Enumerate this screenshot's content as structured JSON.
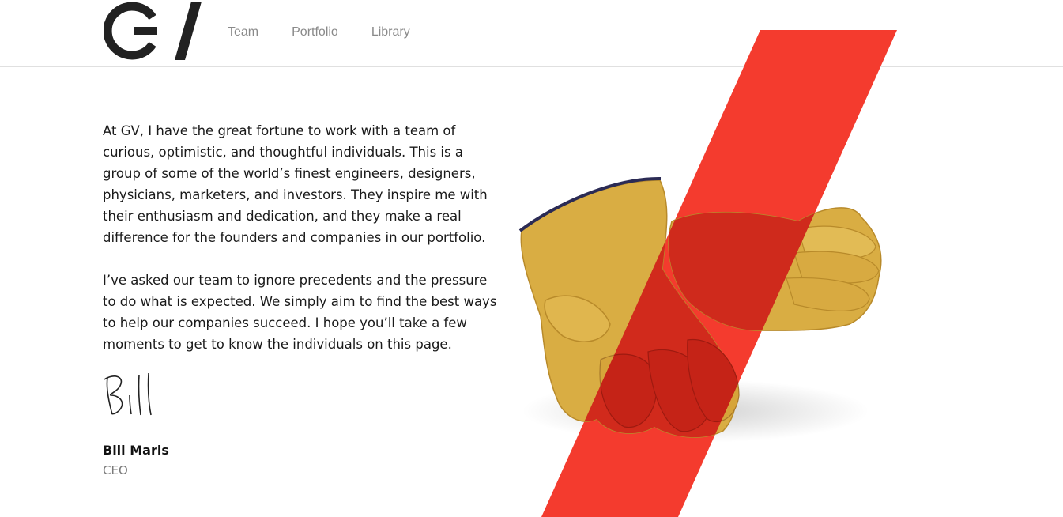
{
  "brand": {
    "logo_text": "GV",
    "logo_color": "#222222"
  },
  "nav": {
    "items": [
      {
        "label": "Team"
      },
      {
        "label": "Portfolio"
      },
      {
        "label": "Library"
      }
    ]
  },
  "intro": {
    "paragraphs": [
      "At GV, I have the great fortune to work with a team of curious, optimistic, and thoughtful individuals. This is a group of some of the world’s finest engineers, designers, physicians, marketers, and investors. They inspire me with their enthusiasm and dedication, and they make a real difference for the founders and companies in our portfolio.",
      "I’ve asked our team to ignore precedents and the pressure to do what is expected. We simply aim to find the best ways to help our companies succeed. I hope you’ll take a few moments to get to know the individuals on this page."
    ],
    "signature_text": "Bill",
    "author_name": "Bill Maris",
    "author_title": "CEO"
  },
  "colors": {
    "accent_red": "#f43b2e",
    "glove_yellow": "#d9ad43",
    "nav_text": "#8a8a8a",
    "body_text": "#1a1a1a"
  }
}
